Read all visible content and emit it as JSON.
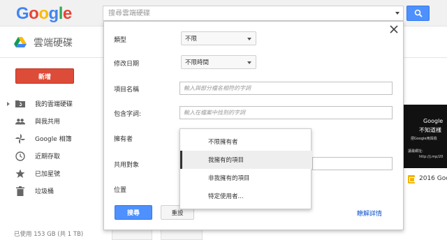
{
  "header": {
    "logo_letters": [
      {
        "ch": "G",
        "color": "#4285f4"
      },
      {
        "ch": "o",
        "color": "#ea4335"
      },
      {
        "ch": "o",
        "color": "#fbbc05"
      },
      {
        "ch": "g",
        "color": "#4285f4"
      },
      {
        "ch": "l",
        "color": "#34a853"
      },
      {
        "ch": "e",
        "color": "#ea4335"
      }
    ],
    "search_placeholder": "搜尋雲端硬碟",
    "search_icon": "search-icon"
  },
  "appbar": {
    "title": "雲端硬碟",
    "icon": "google-drive-icon"
  },
  "sidebar": {
    "new_label": "新增",
    "items": [
      {
        "label": "我的雲端硬碟",
        "icon": "drive-folder-icon"
      },
      {
        "label": "與我共用",
        "icon": "people-icon"
      },
      {
        "label": "Google 相簿",
        "icon": "pinwheel-icon"
      },
      {
        "label": "近期存取",
        "icon": "clock-icon"
      },
      {
        "label": "已加星號",
        "icon": "star-icon"
      },
      {
        "label": "垃圾桶",
        "icon": "trash-icon"
      }
    ],
    "usage": "已使用 153 GB (共 1 TB)"
  },
  "background": {
    "card_lines": [
      "Google",
      "不知道樣",
      "把Google用與檢",
      "讓最網址:",
      "http://j.mp/20"
    ],
    "doc_label": "2016 Goo"
  },
  "advanced_search": {
    "rows": {
      "type_label": "類型",
      "type_value": "不限",
      "modified_label": "修改日期",
      "modified_value": "不限時間",
      "name_label": "項目名稱",
      "name_placeholder": "輸入與部分檔名相符的字詞",
      "contains_label": "包含字詞:",
      "contains_placeholder": "輸入在檔案中找到的字詞",
      "owner_label": "擁有者",
      "shared_label": "共用對象",
      "location_label": "位置"
    },
    "search_button": "搜尋",
    "reset_button": "重設",
    "learn_more": "瞭解詳情"
  },
  "owner_menu": {
    "options": [
      "不限擁有者",
      "我擁有的項目",
      "非我擁有的項目",
      "特定使用者..."
    ],
    "selected_index": 1
  },
  "colors": {
    "primary_blue": "#4d90fe",
    "new_red": "#dd4b39",
    "link": "#15c"
  }
}
